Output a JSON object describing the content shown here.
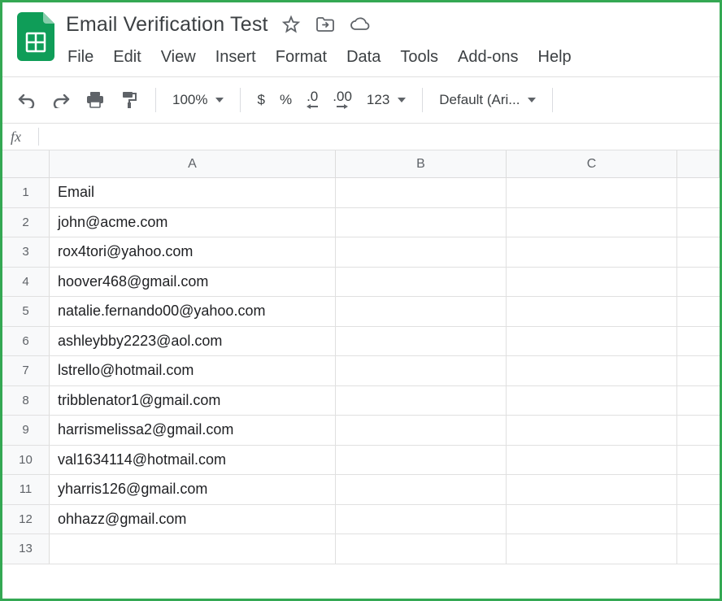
{
  "app": {
    "doc_title": "Email Verification Test"
  },
  "menubar": [
    "File",
    "Edit",
    "View",
    "Insert",
    "Format",
    "Data",
    "Tools",
    "Add-ons",
    "Help"
  ],
  "toolbar": {
    "zoom": "100%",
    "currency": "$",
    "percent": "%",
    "dec_decrease": ".0",
    "dec_increase": ".00",
    "number_format": "123",
    "font": "Default (Ari..."
  },
  "formula_bar": {
    "fx_label": "fx",
    "value": ""
  },
  "grid": {
    "columns": [
      "A",
      "B",
      "C"
    ],
    "rows": [
      {
        "n": "1",
        "A": "Email"
      },
      {
        "n": "2",
        "A": "john@acme.com"
      },
      {
        "n": "3",
        "A": "rox4tori@yahoo.com"
      },
      {
        "n": "4",
        "A": "hoover468@gmail.com"
      },
      {
        "n": "5",
        "A": "natalie.fernando00@yahoo.com"
      },
      {
        "n": "6",
        "A": "ashleybby2223@aol.com"
      },
      {
        "n": "7",
        "A": "lstrello@hotmail.com"
      },
      {
        "n": "8",
        "A": "tribblenator1@gmail.com"
      },
      {
        "n": "9",
        "A": "harrismelissa2@gmail.com"
      },
      {
        "n": "10",
        "A": "val1634114@hotmail.com"
      },
      {
        "n": "11",
        "A": "yharris126@gmail.com"
      },
      {
        "n": "12",
        "A": "ohhazz@gmail.com"
      },
      {
        "n": "13",
        "A": ""
      }
    ]
  }
}
